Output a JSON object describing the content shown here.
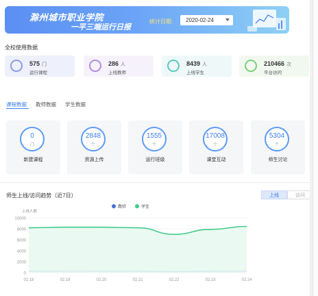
{
  "header": {
    "title": "滁州城市职业学院",
    "subtitle": "一平三端运行日报",
    "date_label": "统计日期:",
    "date_value": "2020-02-24"
  },
  "overview": {
    "title": "全校使用数据",
    "cards": [
      {
        "value": "575",
        "unit": "门",
        "label": "运行课程",
        "bg": "#eef0fb",
        "icon_color": "#8c9be8",
        "icon": "course-icon"
      },
      {
        "value": "286",
        "unit": "人",
        "label": "上线教师",
        "bg": "#f6f2fb",
        "icon_color": "#b48be0",
        "icon": "teacher-icon"
      },
      {
        "value": "8439",
        "unit": "人",
        "label": "上线学生",
        "bg": "#eef8f8",
        "icon_color": "#5cc8c0",
        "icon": "student-icon"
      },
      {
        "value": "210466",
        "unit": "次",
        "label": "平台访问",
        "bg": "#f1f8ef",
        "icon_color": "#7bcf7a",
        "icon": "leaf-icon"
      }
    ]
  },
  "tabs": [
    "课程数据",
    "教师数据",
    "学生数据"
  ],
  "stats": [
    {
      "value": "0",
      "unit": "门",
      "label": "新建课程"
    },
    {
      "value": "2848",
      "unit": "个",
      "label": "资源上传"
    },
    {
      "value": "1555",
      "unit": "个",
      "label": "运行班级"
    },
    {
      "value": "17008",
      "unit": "个",
      "label": "课堂互动"
    },
    {
      "value": "5304",
      "unit": "个",
      "label": "师生讨论"
    }
  ],
  "trend": {
    "title": "师生上线/访问趋势（近7日）",
    "toggle_on": "上线",
    "toggle_off": "访问"
  },
  "chart_data": {
    "type": "area",
    "title": "",
    "ylabel": "上线人数",
    "xlabel": "",
    "x": [
      "02.18",
      "02.19",
      "02.20",
      "02.21",
      "02.22",
      "02.23",
      "02.24"
    ],
    "ylim": [
      0,
      10000
    ],
    "yticks": [
      0,
      2000,
      4000,
      6000,
      8000,
      10000
    ],
    "legend_position": "top-center",
    "series": [
      {
        "name": "教师",
        "color": "#4b6fd8",
        "values": [
          280,
          285,
          282,
          279,
          200,
          270,
          286
        ]
      },
      {
        "name": "学生",
        "color": "#3fcb8a",
        "values": [
          8200,
          8300,
          8300,
          8200,
          7000,
          7900,
          8439
        ]
      }
    ]
  }
}
